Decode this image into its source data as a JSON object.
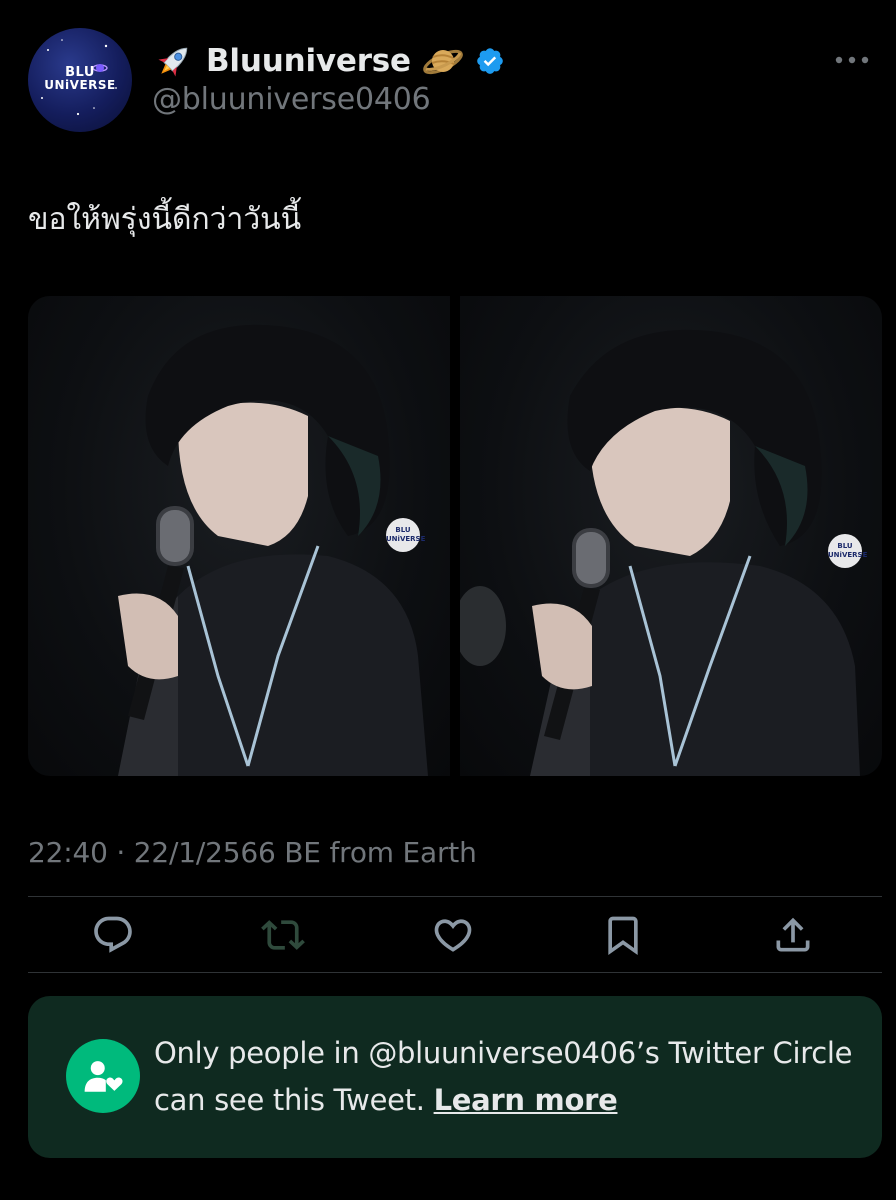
{
  "author": {
    "display_name": "Bluuniverse",
    "handle": "@bluuniverse0406",
    "verified": true,
    "avatar_text_line1": "BLU",
    "avatar_text_line2": "UNiVERSE",
    "name_prefix_icon": "rocket-emoji",
    "name_suffix_icon": "ringed-planet-emoji",
    "verified_color": "#1d9bf0"
  },
  "tweet": {
    "text": "ขอให้พรุ่งนี้ดีกว่าวันนี้",
    "media_count": 2,
    "watermark_line1": "BLU",
    "watermark_line2": "UNiVERSE",
    "timestamp": "22:40 · 22/1/2566 BE from Earth"
  },
  "actions": [
    {
      "name": "reply",
      "icon": "reply-icon"
    },
    {
      "name": "retweet",
      "icon": "retweet-icon"
    },
    {
      "name": "like",
      "icon": "heart-icon"
    },
    {
      "name": "bookmark",
      "icon": "bookmark-icon"
    },
    {
      "name": "share",
      "icon": "share-icon"
    }
  ],
  "circle_notice": {
    "text": "Only people in @bluuniverse0406’s Twitter Circle can see this Tweet.",
    "link_label": "Learn more",
    "icon": "twitter-circle-icon",
    "background_color": "#0f2a20",
    "accent_color": "#00ba7c"
  },
  "colors": {
    "background": "#000000",
    "primary_text": "#e7e9ea",
    "secondary_text": "#71767b",
    "divider": "#2f3336"
  }
}
